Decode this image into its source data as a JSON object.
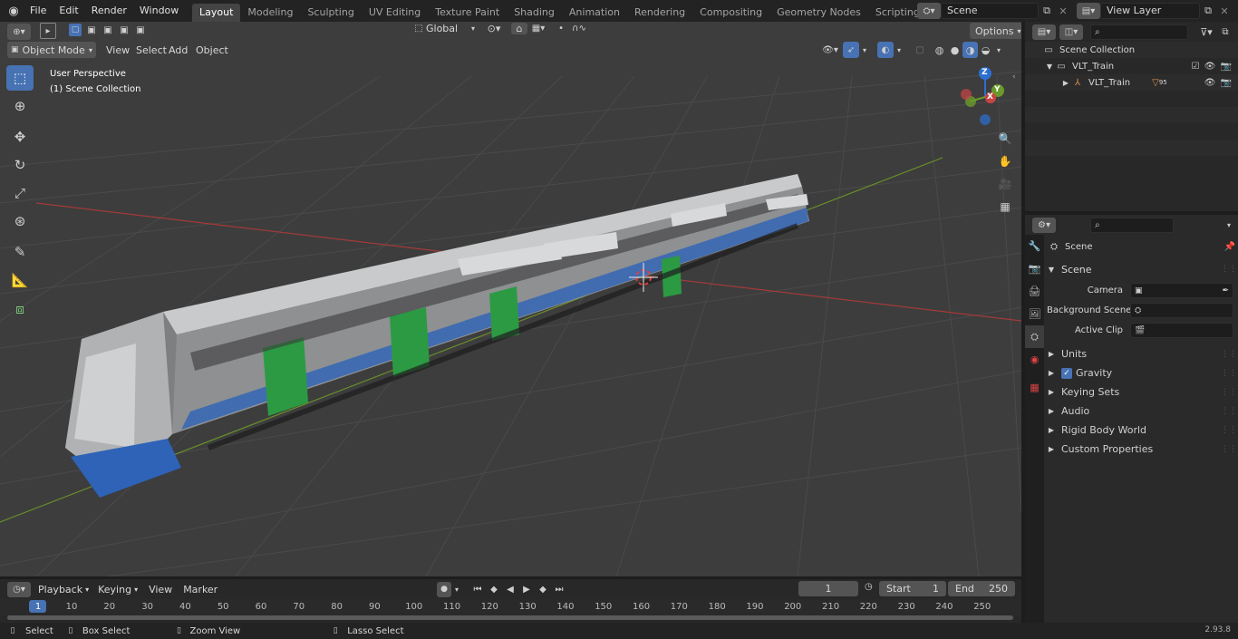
{
  "topbar": {
    "menus": [
      "File",
      "Edit",
      "Render",
      "Window",
      "Help"
    ],
    "workspaces": [
      "Layout",
      "Modeling",
      "Sculpting",
      "UV Editing",
      "Texture Paint",
      "Shading",
      "Animation",
      "Rendering",
      "Compositing",
      "Geometry Nodes",
      "Scripting"
    ],
    "active_workspace": "Layout",
    "scene_name": "Scene",
    "view_layer": "View Layer"
  },
  "viewport": {
    "mode": "Object Mode",
    "menus": [
      "View",
      "Select",
      "Add",
      "Object"
    ],
    "transform_orientation": "Global",
    "options_label": "Options",
    "overlay_title": "User Perspective",
    "overlay_subtitle": "(1) Scene Collection",
    "gizmo_axes": {
      "x": "X",
      "y": "Y",
      "z": "Z"
    },
    "colors": {
      "x_axis": "#a33a3a",
      "y_axis": "#6a8f2a",
      "z_axis": "#2d6fd0",
      "background": "#3d3d3d",
      "grid": "#474747"
    }
  },
  "outliner": {
    "root": "Scene Collection",
    "collection": "VLT_Train",
    "object": "VLT_Train",
    "modifier_count": "95"
  },
  "properties": {
    "context_title": "Scene",
    "section": "Scene",
    "fields": [
      {
        "label": "Camera",
        "value": ""
      },
      {
        "label": "Background Scene",
        "value": ""
      },
      {
        "label": "Active Clip",
        "value": ""
      }
    ],
    "panels": [
      "Units",
      "Gravity",
      "Keying Sets",
      "Audio",
      "Rigid Body World",
      "Custom Properties"
    ],
    "gravity_checked": true
  },
  "timeline": {
    "menus": [
      "Playback",
      "Keying",
      "View",
      "Marker"
    ],
    "current_frame": "1",
    "start_label": "Start",
    "start": "1",
    "end_label": "End",
    "end": "250",
    "ruler": [
      "1",
      "10",
      "20",
      "30",
      "40",
      "50",
      "60",
      "70",
      "80",
      "90",
      "100",
      "110",
      "120",
      "130",
      "140",
      "150",
      "160",
      "170",
      "180",
      "190",
      "200",
      "210",
      "220",
      "230",
      "240",
      "250"
    ]
  },
  "statusbar": {
    "items": [
      "Select",
      "Box Select",
      "Zoom View",
      "Lasso Select"
    ],
    "version": "2.93.8"
  }
}
